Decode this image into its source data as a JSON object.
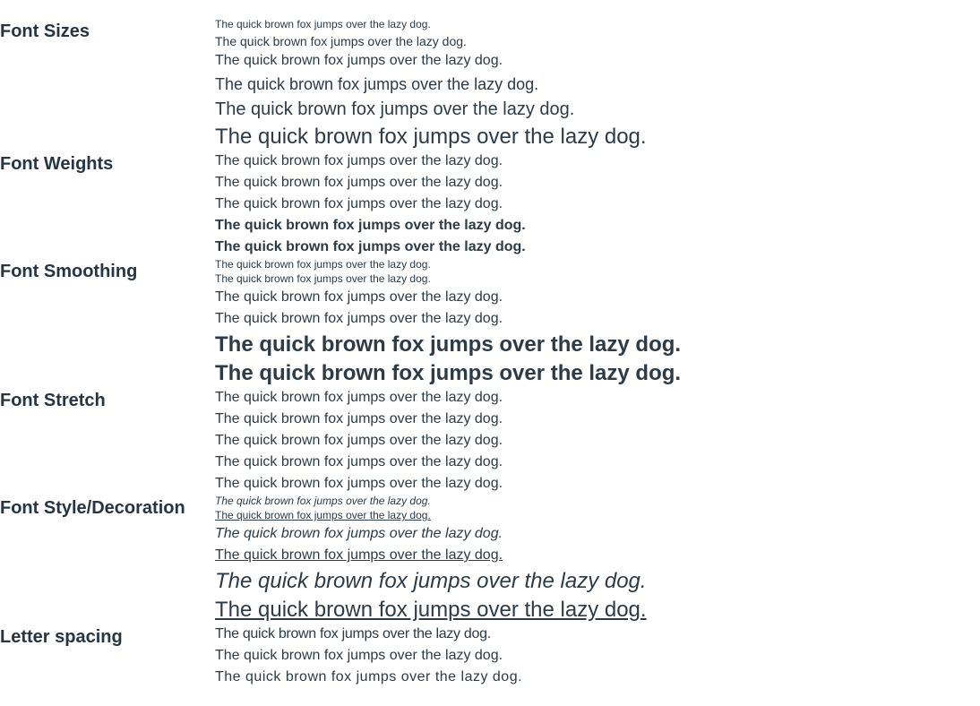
{
  "sections": {
    "font_sizes": "Font Sizes",
    "font_weights": "Font Weights",
    "font_smoothing": "Font Smoothing",
    "font_stretch": "Font Stretch",
    "font_style_decoration": "Font Style/Decoration",
    "letter_spacing": "Letter spacing"
  },
  "sample_text": "The quick brown fox jumps over the lazy dog."
}
